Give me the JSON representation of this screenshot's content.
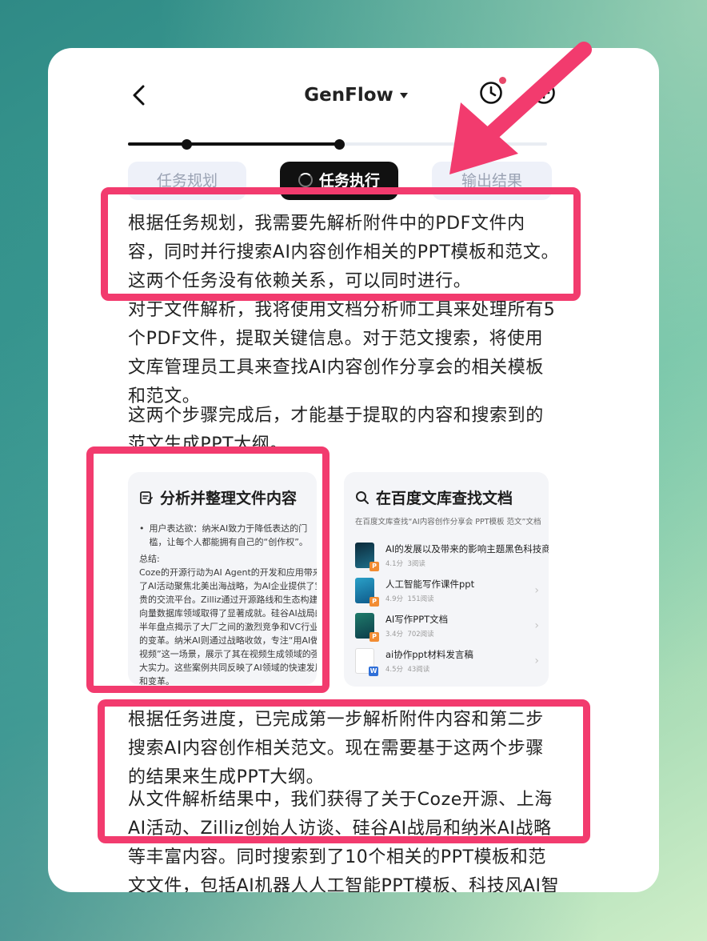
{
  "header": {
    "title": "GenFlow"
  },
  "steps": {
    "tabs": [
      "任务规划",
      "任务执行",
      "输出结果"
    ],
    "active_index": 1
  },
  "paragraphs": {
    "p1": "根据任务规划，我需要先解析附件中的PDF文件内容，同时并行搜索AI内容创作相关的PPT模板和范文。这两个任务没有依赖关系，可以同时进行。",
    "p2": "对于文件解析，我将使用文档分析师工具来处理所有5个PDF文件，提取关键信息。对于范文搜索，将使用文库管理员工具来查找AI内容创作分享会的相关模板和范文。",
    "p3": "这两个步骤完成后，才能基于提取的内容和搜索到的范文生成PPT大纲。",
    "p4": "根据任务进度，已完成第一步解析附件内容和第二步搜索AI内容创作相关范文。现在需要基于这两个步骤的结果来生成PPT大纲。",
    "p5": "从文件解析结果中，我们获得了关于Coze开源、上海AI活动、Zilliz创始人访谈、硅谷AI战局和纳米AI战略等丰富内容。同时搜索到了10个相关的PPT模板和范文文件，包括AI机器人人工智能PPT模板、科技风AI智"
  },
  "analysis_card": {
    "title": "分析并整理文件内容",
    "bullet": "用户表达欲：纳米AI致力于降低表达的门槛，让每个人都能拥有自己的“创作权”。",
    "summary_label": "总结:",
    "summary_lines": [
      "Coze的开源行动为AI Agent的开发和应用带来",
      "了AI活动聚焦北美出海战略，为AI企业提供了宝",
      "贵的交流平台。Zilliz通过开源路线和生态构建",
      "向量数据库领域取得了显著成就。硅谷AI战局的",
      "半年盘点揭示了大厂之间的激烈竞争和VC行业",
      "的变革。纳米AI则通过战略收敛，专注“用AI做",
      "视频”这一场景，展示了其在视频生成领域的强",
      "大实力。这些案例共同反映了AI领域的快速发展",
      "和变革。"
    ]
  },
  "search_card": {
    "title": "在百度文库查找文档",
    "query": "在百度文库查找“AI内容创作分享会 PPT模板 范文”文档",
    "docs": [
      {
        "title": "AI的发展以及带来的影响主题黑色科技商...",
        "score": "4.1分",
        "reads": "3阅读",
        "badge": "P"
      },
      {
        "title": "人工智能写作课件ppt",
        "score": "4.9分",
        "reads": "151阅读",
        "badge": "P"
      },
      {
        "title": "AI写作PPT文档",
        "score": "3.4分",
        "reads": "702阅读",
        "badge": "P"
      },
      {
        "title": "ai协作ppt材料发言稿",
        "score": "4.5分",
        "reads": "43阅读",
        "badge": "W"
      }
    ]
  },
  "colors": {
    "highlight": "#f23b6e",
    "arrow": "#f23b6e",
    "active_tab": "#111111",
    "inactive_tab": "#eef1f9"
  }
}
